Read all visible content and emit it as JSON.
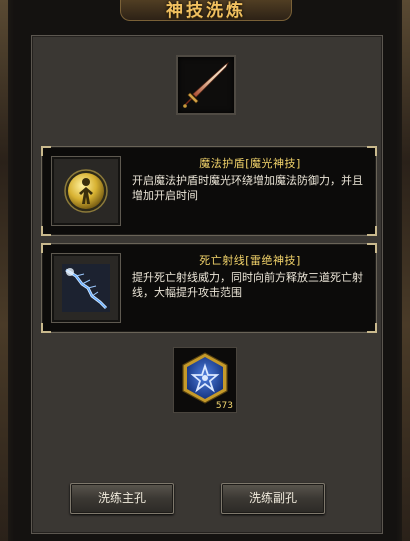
{
  "window": {
    "title": "神技洗炼"
  },
  "equipment_slot": {
    "icon": "sword-icon"
  },
  "skills": [
    {
      "name": "魔法护盾[魔光神技]",
      "description": "开启魔法护盾时魔光环绕增加魔法防御力，并且增加开启时间",
      "icon": "magic-shield-icon"
    },
    {
      "name": "死亡射线[雷绝神技]",
      "description": "提升死亡射线威力，同时向前方释放三道死亡射线，大幅提升攻击范围",
      "icon": "death-ray-icon"
    }
  ],
  "refine_stone": {
    "icon": "blue-gem-icon",
    "count": "573"
  },
  "buttons": {
    "refine_main": "洗练主孔",
    "refine_sub": "洗练副孔"
  },
  "colors": {
    "title": "#f0c060",
    "skill_name": "#f2d36a",
    "gem_count": "#f3d770",
    "panel": "#3a3733"
  }
}
